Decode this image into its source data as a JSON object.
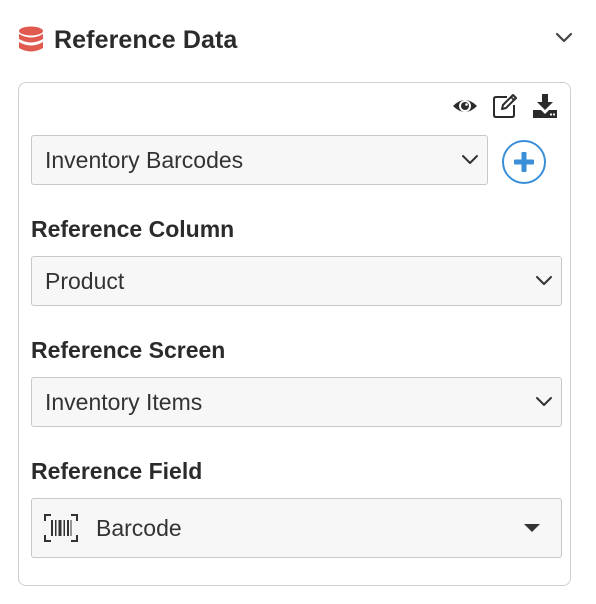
{
  "header": {
    "title": "Reference Data",
    "icon": "database-icon",
    "collapse_icon": "chevron-down-icon"
  },
  "toolbar": {
    "icons": [
      "eye-icon",
      "edit-icon",
      "download-icon"
    ]
  },
  "reference_table": {
    "selected": "Inventory Barcodes",
    "add_icon": "plus-circle-icon"
  },
  "reference_column": {
    "label": "Reference Column",
    "selected": "Product"
  },
  "reference_screen": {
    "label": "Reference Screen",
    "selected": "Inventory Items"
  },
  "reference_field": {
    "label": "Reference Field",
    "selected": "Barcode",
    "icon": "barcode-icon"
  },
  "colors": {
    "accent_red": "#e05a4f",
    "accent_blue": "#3a8fd8",
    "text": "#2b2b2b",
    "border": "#c8c8c8"
  }
}
